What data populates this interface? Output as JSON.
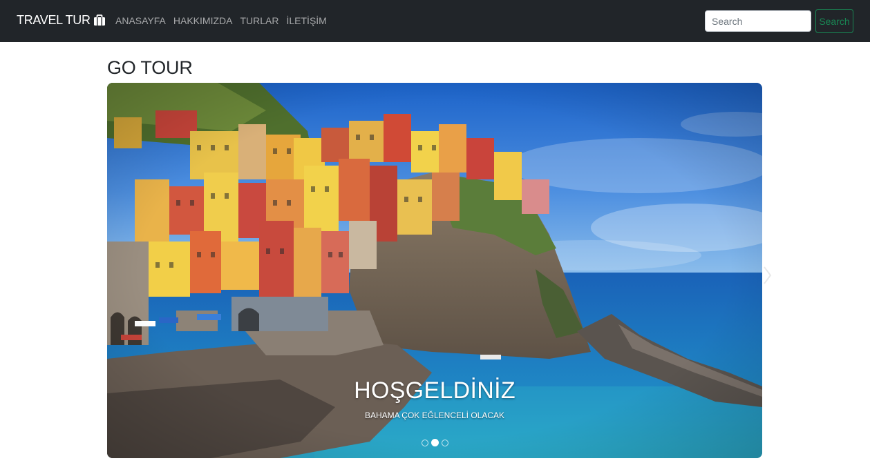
{
  "navbar": {
    "brand": "TRAVEL TUR",
    "brand_icon": "suitcase-icon",
    "links": [
      "ANASAYFA",
      "HAKKIMIZDA",
      "TURLAR",
      "İLETİŞİM"
    ],
    "search_placeholder": "Search",
    "search_button": "Search"
  },
  "main": {
    "title": "GO TOUR"
  },
  "carousel": {
    "image_icon": "coastal-village-photo",
    "caption_title": "HOŞGELDİNİZ",
    "caption_subtitle": "BAHAMA ÇOK EĞLENCELİ OLACAK",
    "slide_count": 3,
    "active_slide": 2,
    "prev_icon": "chevron-left-icon",
    "next_icon": "chevron-right-icon"
  },
  "colors": {
    "navbar_bg": "#212529",
    "search_accent": "#198754"
  }
}
